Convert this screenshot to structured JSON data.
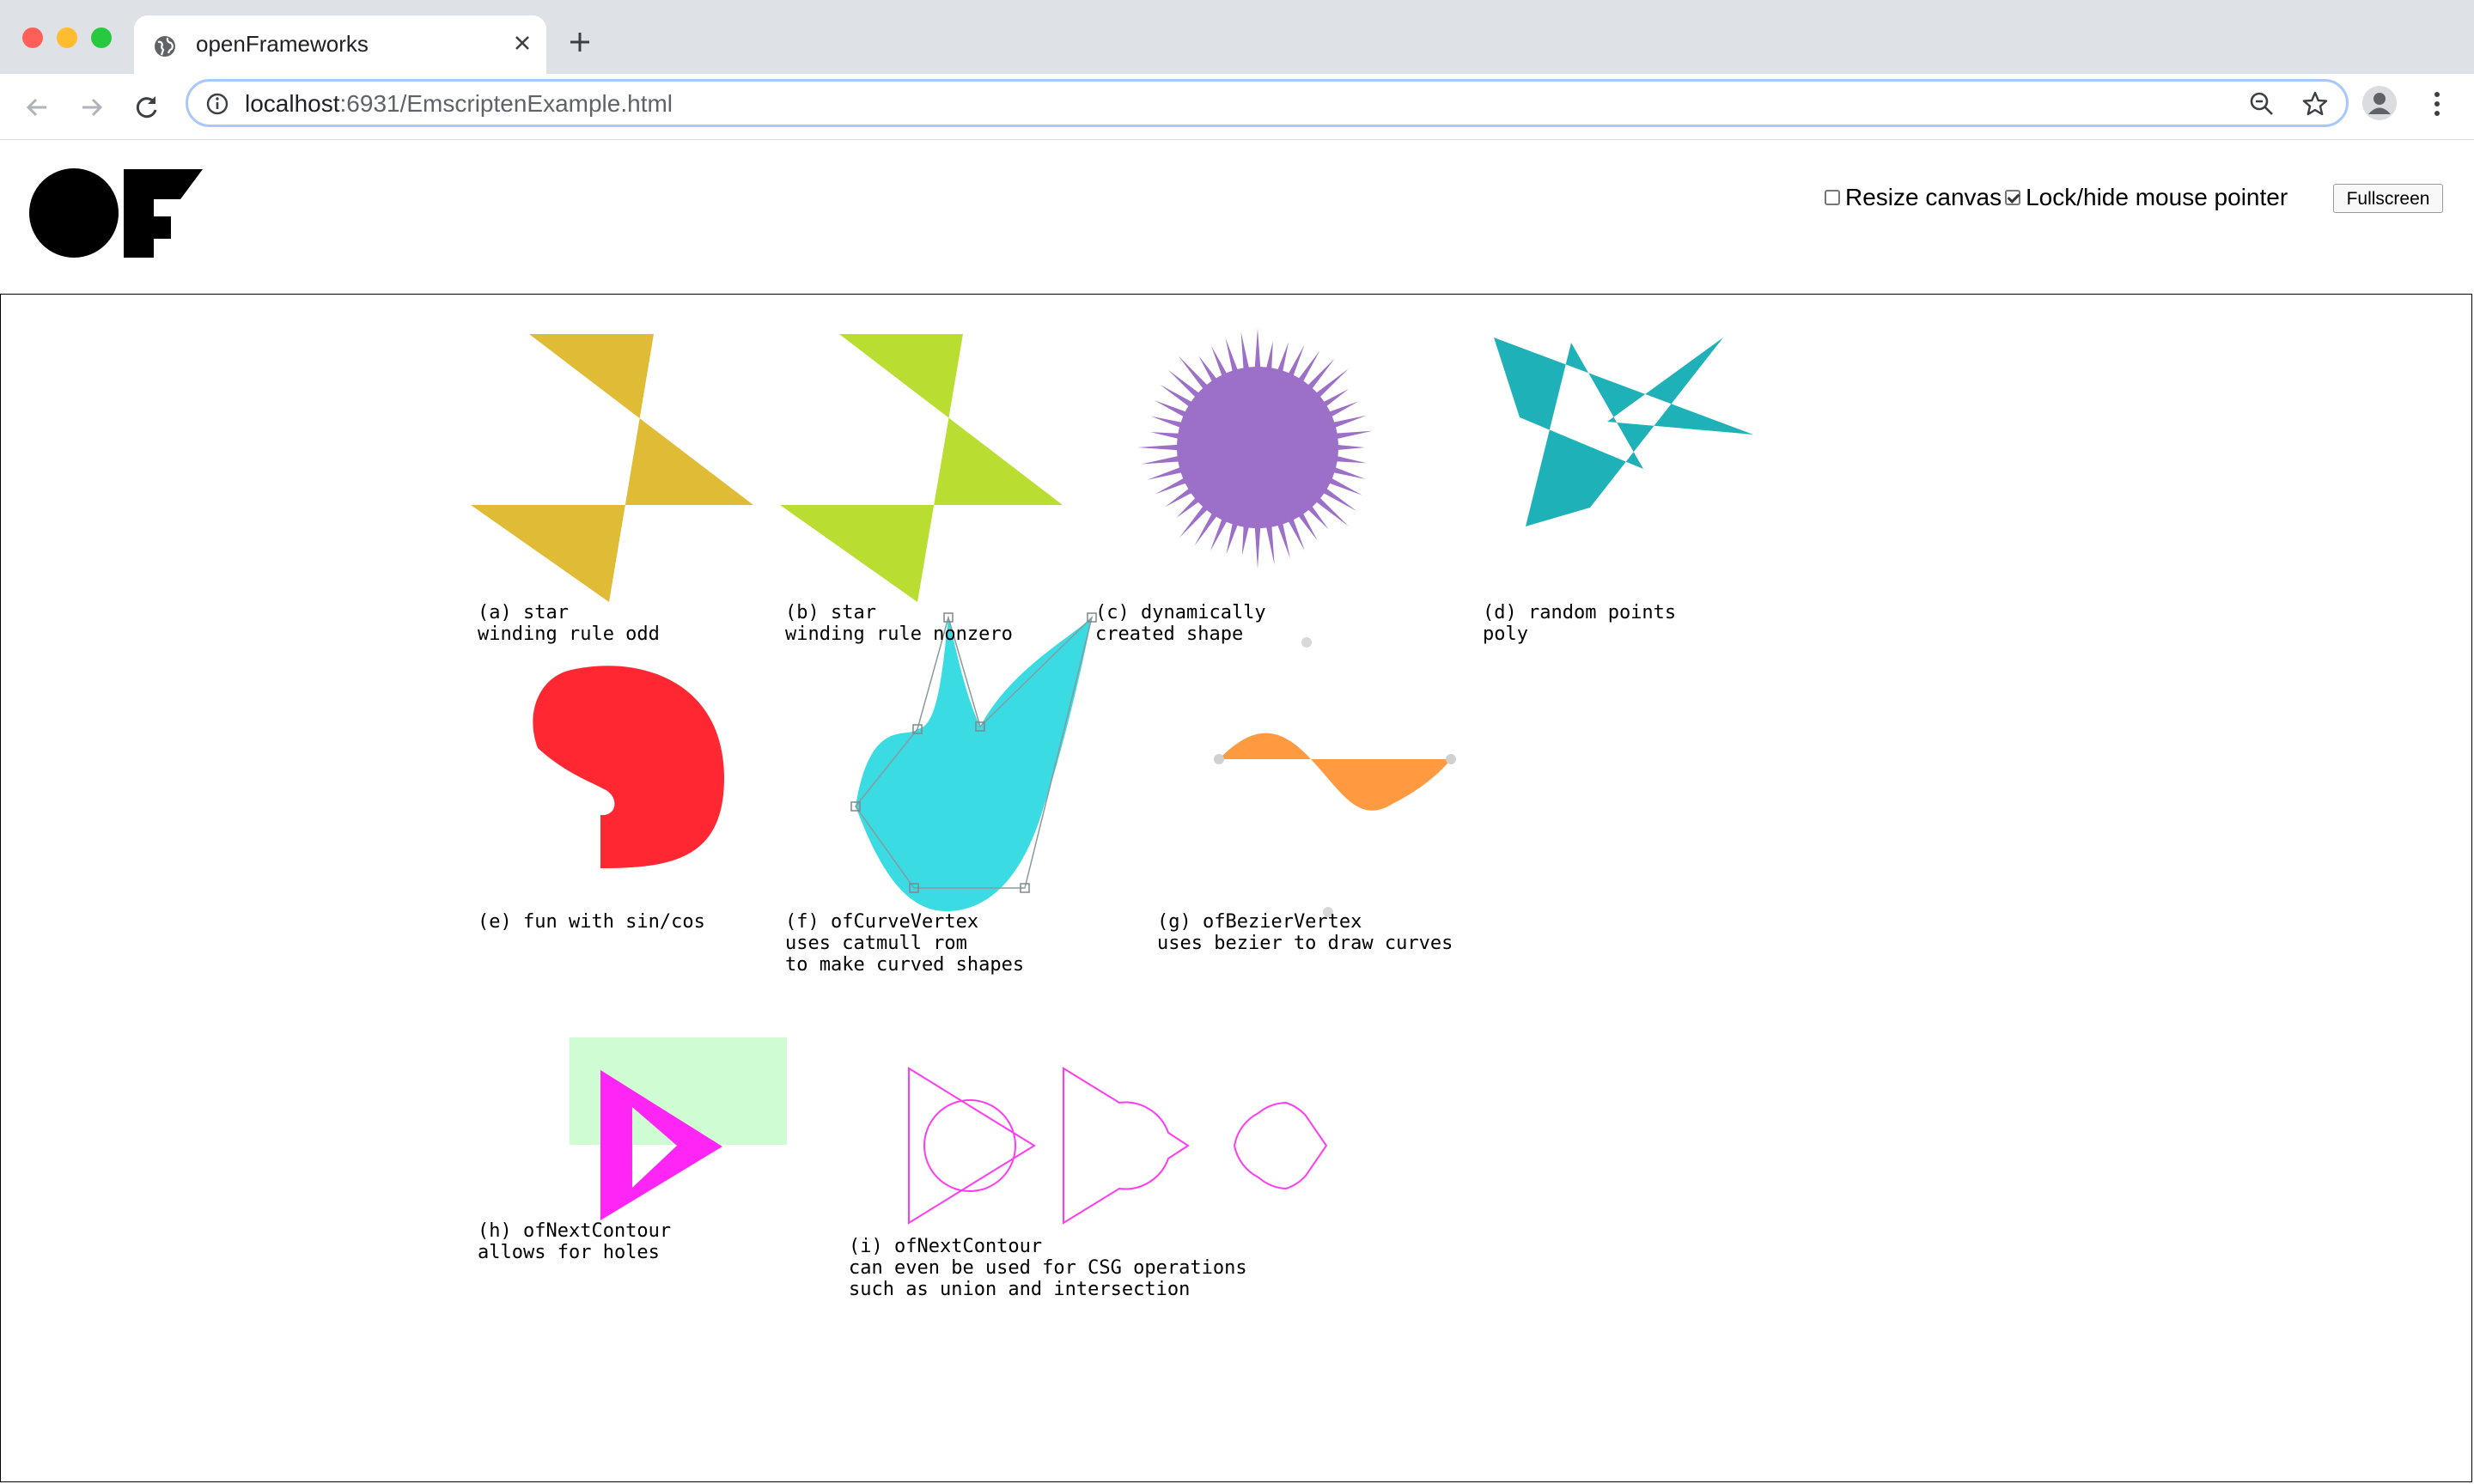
{
  "browser": {
    "tab_title": "openFrameworks",
    "url_host": "localhost",
    "url_rest": ":6931/EmscriptenExample.html"
  },
  "controls": {
    "resize_canvas_label": "Resize canvas",
    "resize_canvas_checked": false,
    "lock_pointer_label": "Lock/hide mouse pointer",
    "lock_pointer_checked": true,
    "fullscreen_label": "Fullscreen"
  },
  "captions": {
    "a": [
      "(a) star",
      "winding rule odd"
    ],
    "b": [
      "(b) star",
      "winding rule nonzero"
    ],
    "c": [
      "(c) dynamically",
      "created shape"
    ],
    "d": [
      "(d) random points",
      "poly"
    ],
    "e": [
      "(e) fun with sin/cos"
    ],
    "f": [
      "(f) ofCurveVertex",
      "uses catmull rom",
      "to make curved shapes"
    ],
    "g": [
      "(g) ofBezierVertex",
      "uses bezier to draw curves"
    ],
    "h": [
      "(h) ofNextContour",
      "allows for holes"
    ],
    "i": [
      "(i) ofNextContour",
      "can even be used for CSG operations",
      "such as union and intersection"
    ]
  },
  "colors": {
    "star_odd": "#e0bb36",
    "star_nonzero": "#b9dd31",
    "sunburst": "#9c6fc8",
    "random_poly": "#1fb1b8",
    "spiral": "#ff2832",
    "curve": "#3adbe3",
    "bezier": "#ff9a40",
    "contour": "#ff25f5",
    "contour_bg": "#d0fcd3",
    "csg": "#ff3cf0"
  },
  "icons": {
    "tab": "globe-icon",
    "close": "close-icon",
    "new_tab": "plus-icon",
    "back": "arrow-left-icon",
    "forward": "arrow-right-icon",
    "reload": "reload-icon",
    "info": "info-icon",
    "zoom": "zoom-out-icon",
    "bookmark": "star-icon",
    "profile": "avatar-icon",
    "menu": "kebab-menu-icon"
  }
}
